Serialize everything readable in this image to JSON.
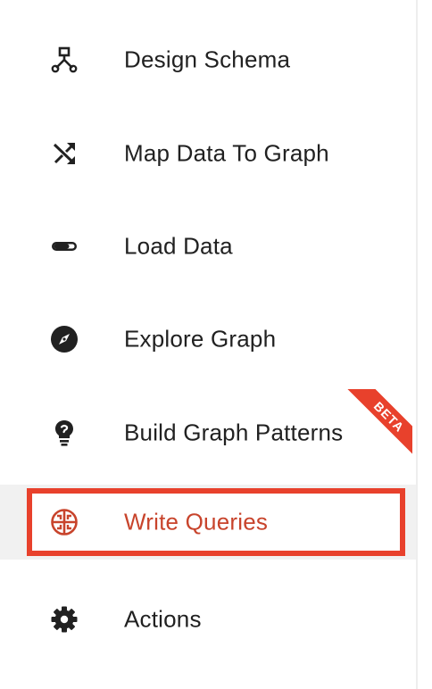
{
  "nav": {
    "items": [
      {
        "label": "Design Schema",
        "icon": "schema-diagram-icon"
      },
      {
        "label": "Map Data To Graph",
        "icon": "shuffle-icon"
      },
      {
        "label": "Load Data",
        "icon": "loading-bar-icon"
      },
      {
        "label": "Explore Graph",
        "icon": "compass-icon"
      },
      {
        "label": "Build Graph Patterns",
        "icon": "lightbulb-icon",
        "badge": "BETA"
      },
      {
        "label": "Write Queries",
        "icon": "query-glyph-icon",
        "selected": true
      },
      {
        "label": "Actions",
        "icon": "gear-icon"
      }
    ]
  },
  "colors": {
    "accent": "#e8412c",
    "selected_text": "#c8442c",
    "text": "#212121",
    "icon": "#212121",
    "selected_bg": "#f1f1f1"
  }
}
